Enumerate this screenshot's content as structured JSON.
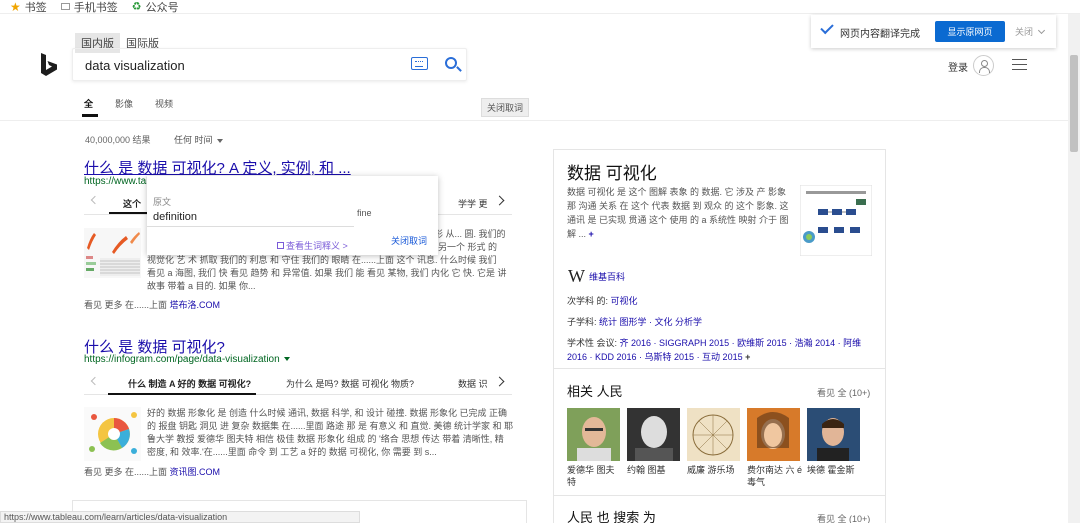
{
  "bookmarks": [
    "书签",
    "手机书签",
    "公众号"
  ],
  "locale_tabs": [
    "国内版",
    "国际版"
  ],
  "search": {
    "query": "data visualization"
  },
  "nav_tabs": [
    "全",
    "影像",
    "视频"
  ],
  "close_translation_small": "关闭取词",
  "translate_bar": {
    "status": "网页内容翻译完成",
    "show_original": "显示原网页",
    "close": "关闭"
  },
  "header": {
    "login": "登录"
  },
  "results_count": "40,000,000 结果",
  "time_filter": "任何 时间",
  "results": [
    {
      "title": "什么 是 数据 可视化? A 定义, 实例, 和 ...",
      "url": "https://www.tableau.com/learn/a",
      "subtabs": [
        "这个",
        "学学 更"
      ],
      "snippet_lines": [
        "形 从... 圆. 我们的",
        "另一个 形式 的",
        "视觉化 艺 术 抓取 我们的 利息 和 守住 我们的 眼睛 在......上面 这个 讯息. 什么时候 我们",
        "看见 a 海图, 我们 快 看见 趋势 和 异常值. 如果 我们 能 看见 某物, 我们 内化 它 快. 它是 讲",
        "故事 带着 a 目的. 如果 你..."
      ],
      "see_more_prefix": "看见 更多 在......上面",
      "see_more_site": "塔布洛.COM"
    },
    {
      "title": "什么 是 数据 可视化?",
      "url": "https://infogram.com/page/data-visualization",
      "subtabs": [
        "什么 制造 A 好的 数据 可视化?",
        "为什么 是吗?  数据 可视化 物质?",
        "数据 识"
      ],
      "snippet_lines": [
        "好的 数据 形象化 是 创造 什么时候 通讯, 数据 科学, 和 设计 碰撞. 数据 形象化 已完成 正确",
        "的 报盘 钥匙 洞见 进 复杂 数据集 在......里面 路途 那 是 有意义 和 直觉. 美德 统计学家 和 耶",
        "鲁大学 教授 爱德华 图夫特 相信 极佳 数据 形象化 组成 的 '络合 思想 传达 带着 清晰性, 精",
        "密度, 和 效率.'在......里面 命令 到 工艺 a 好的 数据 可视化, 你 需要 到 s..."
      ],
      "see_more_prefix": "看见 更多 在......上面",
      "see_more_site": "资讯图.COM"
    }
  ],
  "popup": {
    "label": "原文",
    "word": "definition",
    "right_snippet": "fine",
    "view_link": "查看生词释义 >",
    "close": "关闭取词"
  },
  "knowledge_panel": {
    "title": "数据 可视化",
    "description": "数据 可视化 是 这个 图解 表象 的 数据. 它 涉及 产 影象 那 沟通 关系 在 这个 代表 数据 到 观众 的 这个 影象. 这 通讯 是 已实现 贯通 这个 使用 的 a 系统性 映射 介于 图解 ...",
    "wiki": "维基百科",
    "subject_of_label": "次学科 的:",
    "subject_of": "可视化",
    "subfields_label": "子学科:",
    "subfields": "统计 图形学 · 文化 分析学",
    "conferences_label": "学术性 会议:",
    "conferences": "齐 2016 · SIGGRAPH 2015 · 欧维斯 2015 · 浩瀚 2014 · 阿维 2016 · KDD 2016 · 乌斯特 2015 · 互动 2015",
    "related_title": "相关 人民",
    "see_all": "看见 全 (10+)",
    "people": [
      {
        "name": "爱德华 图夫特"
      },
      {
        "name": "约翰 图基"
      },
      {
        "name": "威廉 游乐场"
      },
      {
        "name": "费尔南达 六 é毒气"
      },
      {
        "name": "埃德 霍金斯"
      }
    ],
    "also_search_title": "人民 也 搜索 为",
    "also_see_all": "看见 全 (10+)"
  },
  "status_url": "https://www.tableau.com/learn/articles/data-visualization",
  "colors": {
    "link": "#1a0dab",
    "url_green": "#006621",
    "accent_blue": "#0b6ad1"
  }
}
